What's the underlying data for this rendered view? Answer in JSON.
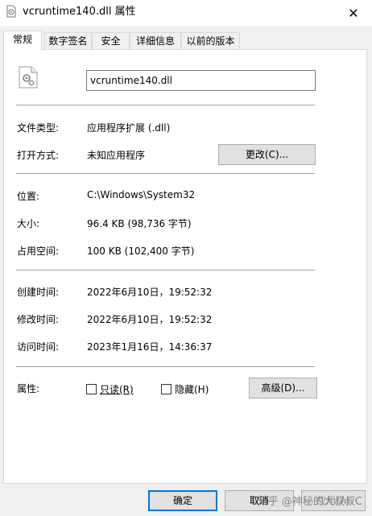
{
  "window": {
    "title": "vcruntime140.dll 属性",
    "close_symbol": "✕"
  },
  "tabs": [
    {
      "label": "常规",
      "active": true
    },
    {
      "label": "数字签名",
      "active": false
    },
    {
      "label": "安全",
      "active": false
    },
    {
      "label": "详细信息",
      "active": false
    },
    {
      "label": "以前的版本",
      "active": false
    }
  ],
  "general": {
    "filename": "vcruntime140.dll",
    "file_type_label": "文件类型:",
    "file_type_value": "应用程序扩展 (.dll)",
    "opens_with_label": "打开方式:",
    "opens_with_value": "未知应用程序",
    "change_button": "更改(C)...",
    "location_label": "位置:",
    "location_value": "C:\\Windows\\System32",
    "size_label": "大小:",
    "size_value": "96.4 KB (98,736 字节)",
    "size_on_disk_label": "占用空间:",
    "size_on_disk_value": "100 KB (102,400 字节)",
    "created_label": "创建时间:",
    "created_value": "2022年6月10日，19:52:32",
    "modified_label": "修改时间:",
    "modified_value": "2022年6月10日，19:52:32",
    "accessed_label": "访问时间:",
    "accessed_value": "2023年1月16日，14:36:37",
    "attributes_label": "属性:",
    "readonly_label": "只读(R)",
    "hidden_label": "隐藏(H)",
    "advanced_button": "高级(D)..."
  },
  "footer": {
    "ok_button": "确定",
    "cancel_button": "取消",
    "apply_button": "应用(A)"
  },
  "watermark": "知乎 @神秘的大叔叔C",
  "colors": {
    "accent": "#0078d7",
    "separator": "#a0a0a0"
  }
}
